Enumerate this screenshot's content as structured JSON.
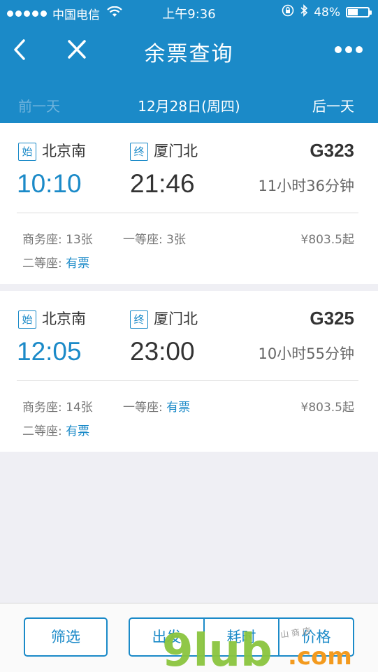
{
  "status_bar": {
    "carrier": "中国电信",
    "time": "上午9:36",
    "battery": "48%",
    "battery_level": 0.48,
    "icons": [
      "signal-dots",
      "wifi-icon",
      "lock-rotation-icon",
      "bluetooth-icon",
      "battery-icon"
    ]
  },
  "nav": {
    "title": "余票查询",
    "back_icon": "chevron-left-icon",
    "close_icon": "close-icon",
    "more_icon": "more-dots-icon"
  },
  "date_bar": {
    "prev": "前一天",
    "current": "12月28日(周四)",
    "next": "后一天"
  },
  "trains": [
    {
      "from_badge": "始",
      "from_station": "北京南",
      "to_badge": "终",
      "to_station": "厦门北",
      "train_no": "G323",
      "depart": "10:10",
      "arrive": "21:46",
      "duration": "11小时36分钟",
      "seats": [
        {
          "label": "商务座: ",
          "value": "13张",
          "available": false
        },
        {
          "label": "一等座: ",
          "value": "3张",
          "available": false
        },
        {
          "label": "二等座: ",
          "value": "有票",
          "available": true
        }
      ],
      "price": "¥803.5起"
    },
    {
      "from_badge": "始",
      "from_station": "北京南",
      "to_badge": "终",
      "to_station": "厦门北",
      "train_no": "G325",
      "depart": "12:05",
      "arrive": "23:00",
      "duration": "10小时55分钟",
      "seats": [
        {
          "label": "商务座: ",
          "value": "14张",
          "available": false
        },
        {
          "label": "一等座: ",
          "value": "有票",
          "available": true
        },
        {
          "label": "二等座: ",
          "value": "有票",
          "available": true
        }
      ],
      "price": "¥803.5起"
    }
  ],
  "toolbar": {
    "filter": "筛选",
    "sort_depart": "出发",
    "sort_duration": "耗时",
    "sort_price": "价格"
  },
  "watermark": {
    "text": "9lub.com",
    "small_text": "山 商 店"
  },
  "colors": {
    "header": "#1b8ac8",
    "accent": "#1b8ac8",
    "background": "#efeff4",
    "watermark_green": "#8bc53f",
    "watermark_orange": "#f39a1e"
  }
}
